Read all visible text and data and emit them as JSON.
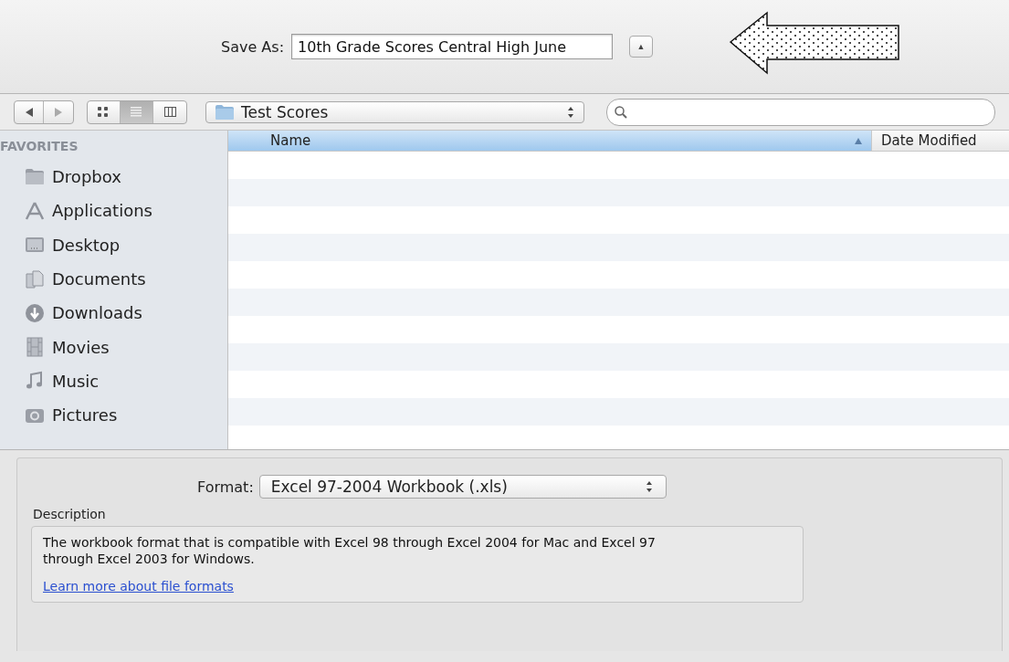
{
  "save_as": {
    "label": "Save As:",
    "value": "10th Grade Scores Central High June",
    "expand_button": "▲"
  },
  "toolbar": {
    "view_modes": [
      {
        "kind": "icons",
        "selected": false
      },
      {
        "kind": "list",
        "selected": true
      },
      {
        "kind": "columns",
        "selected": false
      }
    ],
    "location": "Test Scores"
  },
  "sidebar": {
    "heading": "FAVORITES",
    "items": [
      {
        "kind": "folder",
        "label": "Dropbox"
      },
      {
        "kind": "applications",
        "label": "Applications"
      },
      {
        "kind": "desktop",
        "label": "Desktop"
      },
      {
        "kind": "documents",
        "label": "Documents"
      },
      {
        "kind": "downloads",
        "label": "Downloads"
      },
      {
        "kind": "movies",
        "label": "Movies"
      },
      {
        "kind": "music",
        "label": "Music"
      },
      {
        "kind": "pictures",
        "label": "Pictures"
      }
    ]
  },
  "table": {
    "columns": [
      {
        "label": "Name",
        "selected": true
      },
      {
        "label": "Date Modified",
        "selected": false
      }
    ]
  },
  "format": {
    "label": "Format:",
    "value": "Excel 97-2004 Workbook (.xls)",
    "description_label": "Description",
    "description": "The workbook format that is compatible with Excel 98 through Excel 2004 for Mac and Excel 97 through Excel 2003 for Windows.",
    "link": "Learn more about file formats"
  }
}
